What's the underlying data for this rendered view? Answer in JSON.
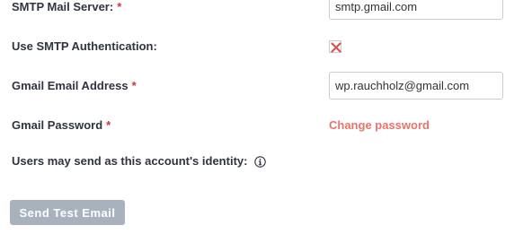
{
  "form": {
    "smtp_server": {
      "label": "SMTP Mail Server:",
      "required_mark": "*",
      "value": "smtp.gmail.com"
    },
    "smtp_auth": {
      "label": "Use SMTP Authentication:",
      "checked": true
    },
    "gmail_address": {
      "label": "Gmail Email Address",
      "required_mark": "*",
      "value": "wp.rauchholz@gmail.com"
    },
    "gmail_password": {
      "label": "Gmail Password",
      "required_mark": "*",
      "link": "Change password"
    },
    "send_as_identity": {
      "label": "Users may send as this account's identity:",
      "icon": "info-icon"
    },
    "send_test_button": "Send Test Email"
  },
  "colors": {
    "required": "#d0343b",
    "link": "#e8736a",
    "button_bg": "#a7b2bc",
    "checkbox_mark": "#d9534f"
  }
}
